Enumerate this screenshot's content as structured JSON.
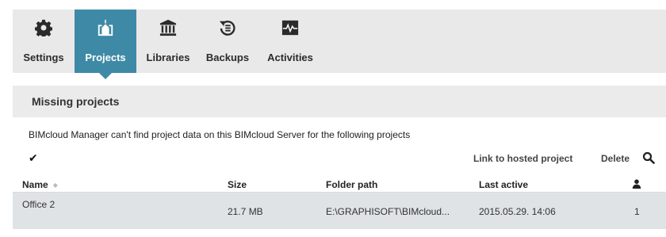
{
  "toolbar": {
    "tabs": [
      {
        "label": "Settings",
        "icon": "gear-icon"
      },
      {
        "label": "Projects",
        "icon": "projects-icon",
        "active": true
      },
      {
        "label": "Libraries",
        "icon": "library-icon"
      },
      {
        "label": "Backups",
        "icon": "backup-icon"
      },
      {
        "label": "Activities",
        "icon": "activity-icon"
      }
    ],
    "active_color": "#3e8aa6"
  },
  "section": {
    "title": "Missing projects"
  },
  "notice": "BIMcloud Manager can't find project data on this BIMcloud Server for the following projects",
  "actions": {
    "check_glyph": "✔",
    "link_label": "Link to hosted project",
    "delete_label": "Delete",
    "search_icon": "search-icon"
  },
  "table": {
    "columns": [
      "Name",
      "Size",
      "Folder path",
      "Last active"
    ],
    "user_column_icon": "user-icon",
    "sort_glyph": "◆",
    "rows": [
      {
        "name": "Office 2",
        "size": "21.7 MB",
        "folder": "E:\\GRAPHISOFT\\BIMcloud...",
        "last_active": "2015.05.29. 14:06",
        "users": "1"
      }
    ]
  }
}
